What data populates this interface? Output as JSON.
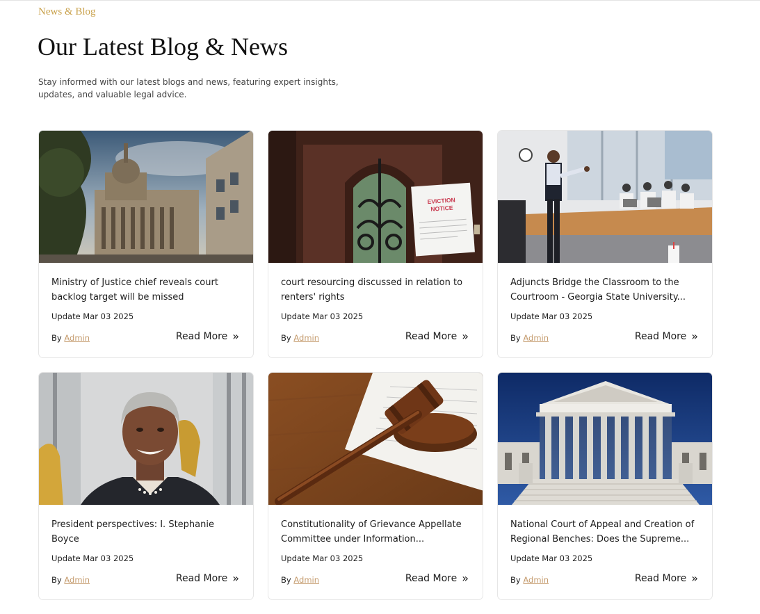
{
  "section": {
    "eyebrow": "News & Blog",
    "title": "Our Latest Blog & News",
    "subtitle": "Stay informed with our latest blogs and news, featuring expert insights, updates, and valuable legal advice."
  },
  "labels": {
    "by": "By",
    "read_more": "Read More",
    "read_more_icon": "double-chevron-right-icon"
  },
  "notice": {
    "line1": "EVICTION",
    "line2": "NOTICE"
  },
  "posts": [
    {
      "title": "Ministry of Justice chief reveals court backlog target will be missed",
      "date": "Update Mar 03 2025",
      "author": "Admin",
      "image": "courthouse-building"
    },
    {
      "title": "court resourcing discussed in relation to renters' rights",
      "date": "Update Mar 03 2025",
      "author": "Admin",
      "image": "eviction-notice-door"
    },
    {
      "title": "Adjuncts Bridge the Classroom to the Courtroom - Georgia State University...",
      "date": "Update Mar 03 2025",
      "author": "Admin",
      "image": "classroom-lecture"
    },
    {
      "title": "President perspectives: I. Stephanie Boyce",
      "date": "Update Mar 03 2025",
      "author": "Admin",
      "image": "portrait"
    },
    {
      "title": "Constitutionality of Grievance Appellate Committee under Information...",
      "date": "Update Mar 03 2025",
      "author": "Admin",
      "image": "gavel-document"
    },
    {
      "title": "National Court of Appeal and Creation of Regional Benches: Does the Supreme...",
      "date": "Update Mar 03 2025",
      "author": "Admin",
      "image": "supreme-court"
    }
  ]
}
